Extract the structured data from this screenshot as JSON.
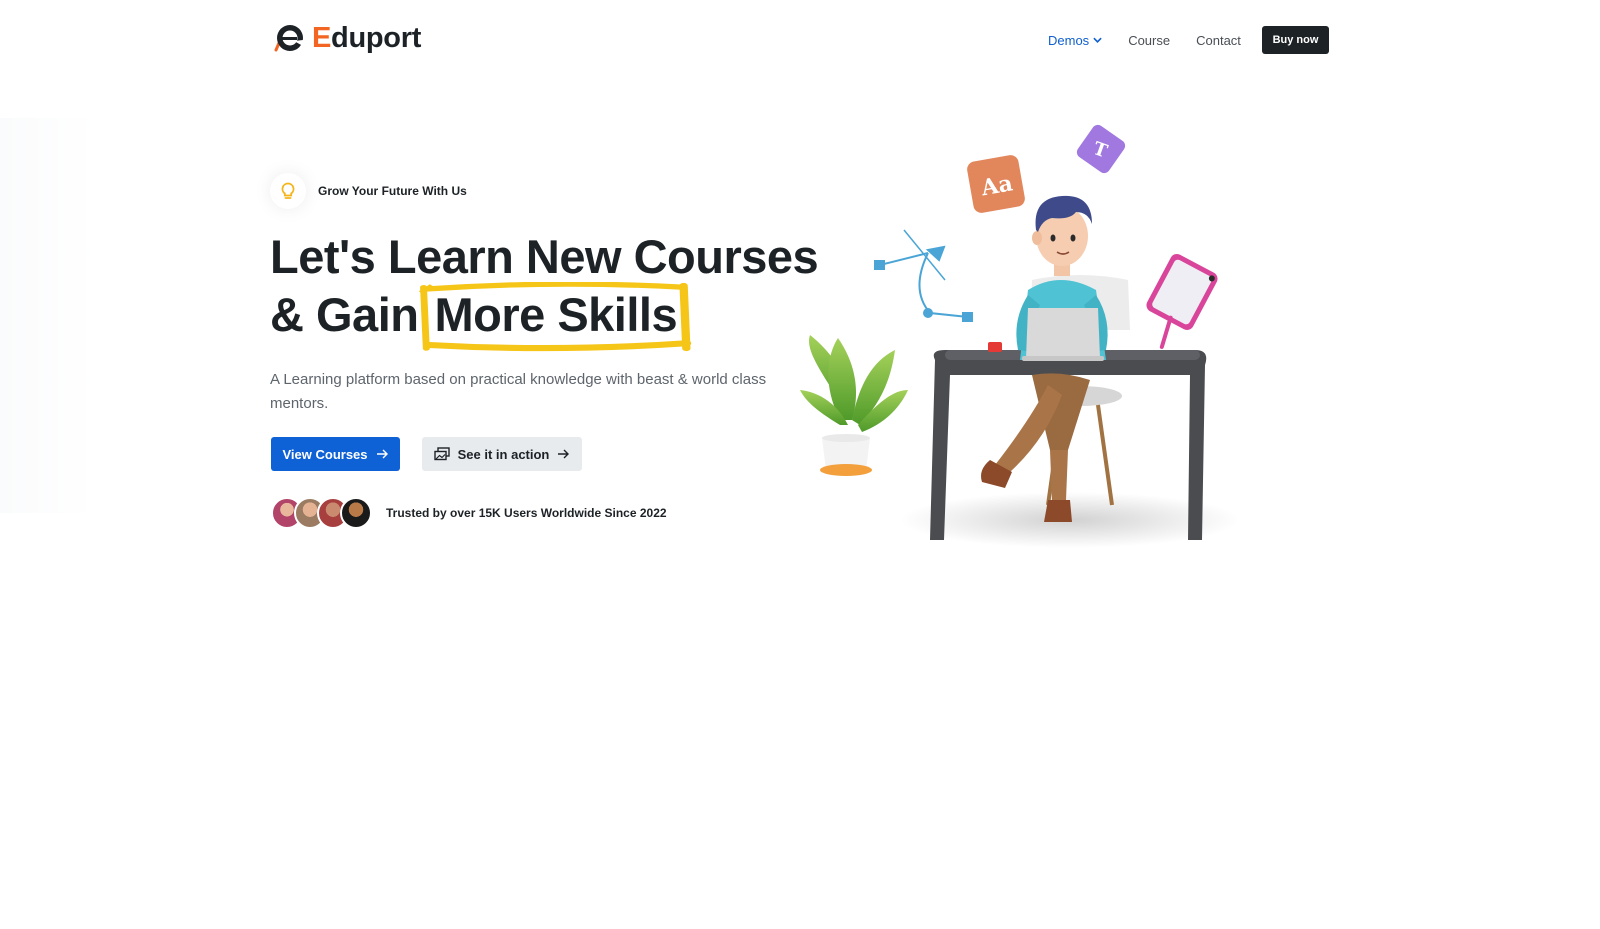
{
  "brand": {
    "first_letter": "E",
    "rest": "duport"
  },
  "nav": {
    "items": [
      {
        "label": "Demos"
      },
      {
        "label": "Course"
      },
      {
        "label": "Contact"
      }
    ],
    "buy_label": "Buy now"
  },
  "hero": {
    "badge": "Grow Your Future With Us",
    "headline_line1": "Let's Learn New Courses",
    "headline_line2_prefix": "& Gain",
    "headline_highlight": "More Skills",
    "subtitle": "A Learning platform based on practical knowledge with beast & world class mentors.",
    "primary_button": "View Courses",
    "secondary_button": "See it in action",
    "trusted_text": "Trusted by over 15K Users Worldwide Since 2022"
  },
  "icons": {
    "logo": "eduport-logo-icon",
    "bulb": "lightbulb-icon",
    "arrow": "arrow-right-icon",
    "gallery": "gallery-icon",
    "chevron": "chevron-down-icon"
  },
  "colors": {
    "accent": "#0f62d6",
    "brand_orange": "#f26522",
    "dark": "#1d2226",
    "highlight_yellow": "#f5c518",
    "nav_active": "#0f5fcf"
  }
}
